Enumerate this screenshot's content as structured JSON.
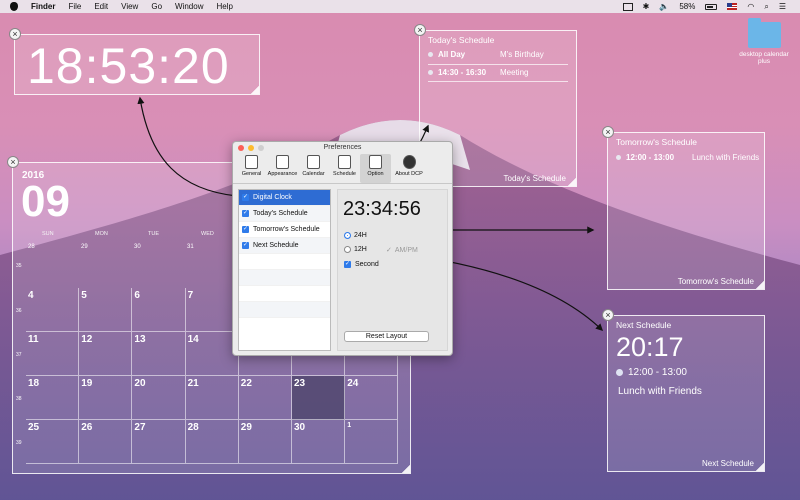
{
  "menubar": {
    "app": "Finder",
    "items": [
      "File",
      "Edit",
      "View",
      "Go",
      "Window",
      "Help"
    ],
    "battery": "58%"
  },
  "desktop_icon": {
    "label": "desktop calendar plus"
  },
  "clock_widget": {
    "time": "18:53:20"
  },
  "today": {
    "title": "Today's Schedule",
    "rows": [
      {
        "time": "All Day",
        "event": "M's Birthday"
      },
      {
        "time": "14:30 - 16:30",
        "event": "Meeting"
      }
    ],
    "footer": "Today's Schedule"
  },
  "tomorrow": {
    "title": "Tomorrow's Schedule",
    "rows": [
      {
        "time": "12:00 - 13:00",
        "event": "Lunch with Friends"
      }
    ],
    "footer": "Tomorrow's Schedule"
  },
  "next": {
    "title": "Next Schedule",
    "time": "20:17",
    "range": "12:00 - 13:00",
    "event": "Lunch with Friends",
    "footer": "Next Schedule"
  },
  "calendar": {
    "year": "2016",
    "month": "09",
    "dow": [
      "SUN",
      "MON",
      "TUE",
      "WED"
    ],
    "prev_days": [
      "28",
      "29",
      "30",
      "31"
    ],
    "weeks": [
      "35",
      "36",
      "37",
      "38",
      "39"
    ],
    "rows": [
      [
        "4",
        "5",
        "6",
        "7",
        "",
        "",
        ""
      ],
      [
        "11",
        "12",
        "13",
        "14",
        "",
        "",
        ""
      ],
      [
        "18",
        "19",
        "20",
        "21",
        "22",
        "23",
        "24"
      ],
      [
        "25",
        "26",
        "27",
        "28",
        "29",
        "30",
        "1"
      ]
    ]
  },
  "prefs": {
    "title": "Preferences",
    "tabs": [
      {
        "label": "General"
      },
      {
        "label": "Appearance"
      },
      {
        "label": "Calendar"
      },
      {
        "label": "Schedule"
      },
      {
        "label": "Option"
      },
      {
        "label": "About DCP"
      }
    ],
    "items": [
      "Digital Clock",
      "Today's Schedule",
      "Tomorrow's Schedule",
      "Next Schedule"
    ],
    "preview_time": "23:34:56",
    "opt_24h": "24H",
    "opt_12h": "12H",
    "opt_ampm": "AM/PM",
    "opt_second": "Second",
    "reset": "Reset Layout"
  }
}
